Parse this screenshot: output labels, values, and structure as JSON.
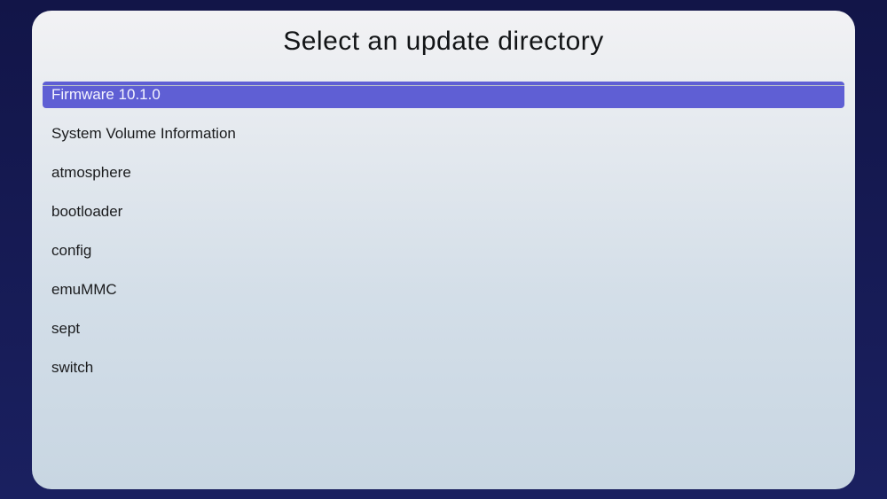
{
  "header": {
    "title": "Select an update directory"
  },
  "list": {
    "selected_index": 0,
    "items": [
      {
        "label": "Firmware 10.1.0"
      },
      {
        "label": "System Volume Information"
      },
      {
        "label": "atmosphere"
      },
      {
        "label": "bootloader"
      },
      {
        "label": "config"
      },
      {
        "label": "emuMMC"
      },
      {
        "label": "sept"
      },
      {
        "label": "switch"
      }
    ]
  }
}
